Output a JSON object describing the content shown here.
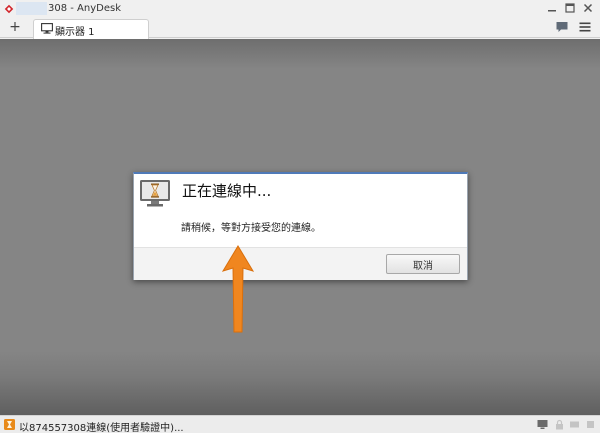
{
  "window": {
    "title": "308 - AnyDesk"
  },
  "tabs": [
    {
      "label": "顯示器 1",
      "icon": "monitor-icon"
    }
  ],
  "toolbar": {
    "add_tab": "+",
    "chat_icon": "chat-icon",
    "menu_icon": "hamburger-menu-icon"
  },
  "dialog": {
    "title": "正在連線中...",
    "message": "請稍候，等對方接受您的連線。",
    "cancel_label": "取消",
    "icon": "hourglass-monitor-icon"
  },
  "status": {
    "text": "以874557308連線(使用者驗證中)..."
  },
  "colors": {
    "accent": "#4f7ab8",
    "viewport": "#858585",
    "arrow": "#f0861f",
    "logo": "#d2262b"
  }
}
